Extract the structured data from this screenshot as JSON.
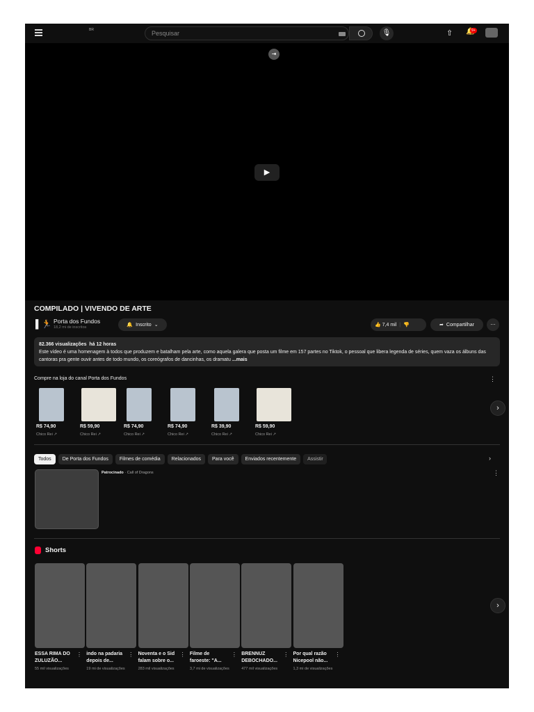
{
  "header": {
    "region": "BR",
    "search_placeholder": "Pesquisar",
    "notifications": "9+"
  },
  "video": {
    "title": "COMPILADO | VIVENDO DE ARTE"
  },
  "channel": {
    "name": "Porta dos Fundos",
    "subscribers": "18,2 mi de inscritos",
    "subscribe_label": "Inscrito"
  },
  "actions": {
    "likes": "7,4 mil",
    "share": "Compartilhar"
  },
  "description": {
    "views": "82.366 visualizações",
    "age": "há 12 horas",
    "text": "Este vídeo é uma homenagem à todos que produzem e batalham pela arte, como aquela galera que posta um filme em 157 partes no Tiktok, o pessoal que libera legenda de séries, quem vaza os álbuns das cantoras pra gente ouvir antes de todo mundo, os coreógrafos de dancinhas, os dramatu",
    "more": "...mais"
  },
  "shop": {
    "title": "Compre na loja do canal Porta dos Fundos",
    "products": [
      {
        "price": "R$ 74,90",
        "seller": "Chico Rei"
      },
      {
        "price": "R$ 59,90",
        "seller": "Chico Rei"
      },
      {
        "price": "R$ 74,90",
        "seller": "Chico Rei"
      },
      {
        "price": "R$ 74,90",
        "seller": "Chico Rei"
      },
      {
        "price": "R$ 39,90",
        "seller": "Chico Rei"
      },
      {
        "price": "R$ 59,90",
        "seller": "Chico Rei"
      }
    ]
  },
  "chips": [
    "Todos",
    "De Porta dos Fundos",
    "Filmes de comédia",
    "Relacionados",
    "Para você",
    "Enviados recentemente",
    "Assistir"
  ],
  "ad": {
    "label": "Patrocinado",
    "advertiser": "· Call of Dragons"
  },
  "shorts": {
    "title": "Shorts",
    "items": [
      {
        "title": "ESSA RIMA DO ZULUZÃO...",
        "views": "55 mil visualizações"
      },
      {
        "title": "indo na padaria depois de...",
        "views": "19 mi de visualizações"
      },
      {
        "title": "Noventa e o Sid falam sobre o...",
        "views": "283 mil visualizações"
      },
      {
        "title": "Filme de faroeste: \"A...",
        "views": "3,7 mi de visualizações"
      },
      {
        "title": "BRENNUZ DEBOCHADO...",
        "views": "477 mil visualizações"
      },
      {
        "title": "Por qual razão Nicepool não...",
        "views": "1,3 mi de visualizações"
      }
    ]
  }
}
